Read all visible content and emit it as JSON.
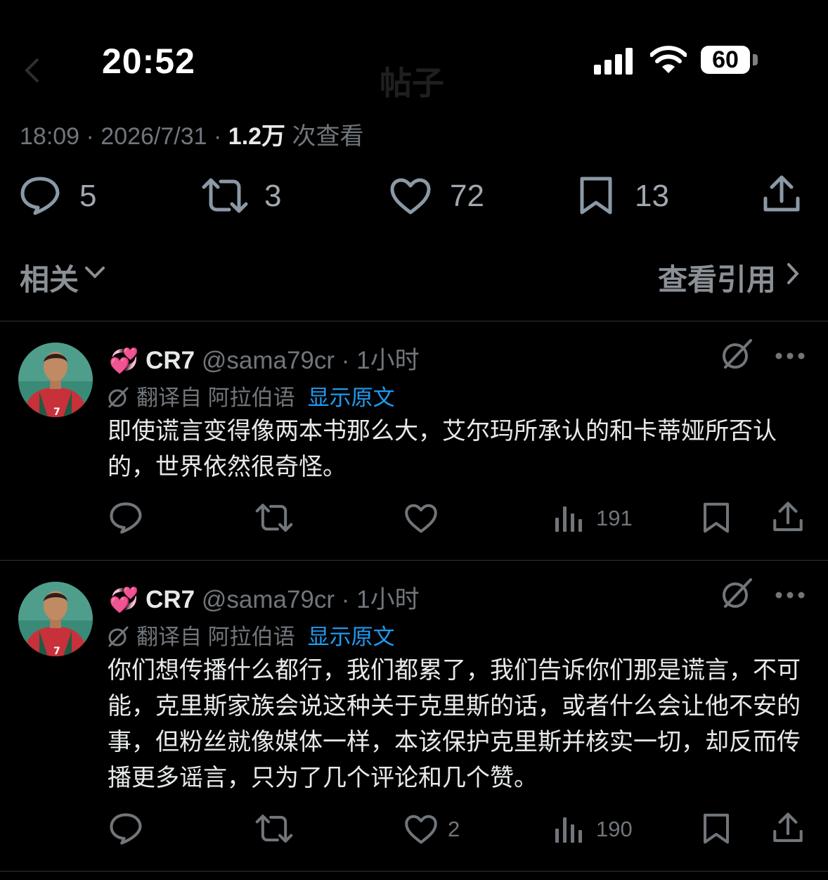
{
  "status_bar": {
    "time": "20:52",
    "battery": "60"
  },
  "nav": {
    "title": "帖子"
  },
  "post": {
    "meta": {
      "time_date": "18:09 · 2026/7/31 · ",
      "views_count": "1.2万",
      "views_label": " 次查看"
    },
    "stats": {
      "replies": "5",
      "reposts": "3",
      "likes": "72",
      "bookmarks": "13"
    }
  },
  "related_bar": {
    "related_label": "相关",
    "quotes_label": "查看引用"
  },
  "replies": [
    {
      "emoji": "💞",
      "name": "CR7",
      "handle": "@sama79cr",
      "time": " · 1小时",
      "translated_label": "翻译自 阿拉伯语",
      "show_original": "显示原文",
      "text": "即使谎言变得像两本书那么大，艾尔玛所承认的和卡蒂娅所否认的，世界依然很奇怪。",
      "likes": "",
      "views": "191"
    },
    {
      "emoji": "💞",
      "name": "CR7",
      "handle": "@sama79cr",
      "time": " · 1小时",
      "translated_label": "翻译自 阿拉伯语",
      "show_original": "显示原文",
      "text": "你们想传播什么都行，我们都累了，我们告诉你们那是谎言，不可能，克里斯家族会说这种关于克里斯的话，或者什么会让他不安的事，但粉丝就像媒体一样，本该保护克里斯并核实一切，却反而传播更多谣言，只为了几个评论和几个赞。",
      "likes": "2",
      "views": "190"
    }
  ]
}
